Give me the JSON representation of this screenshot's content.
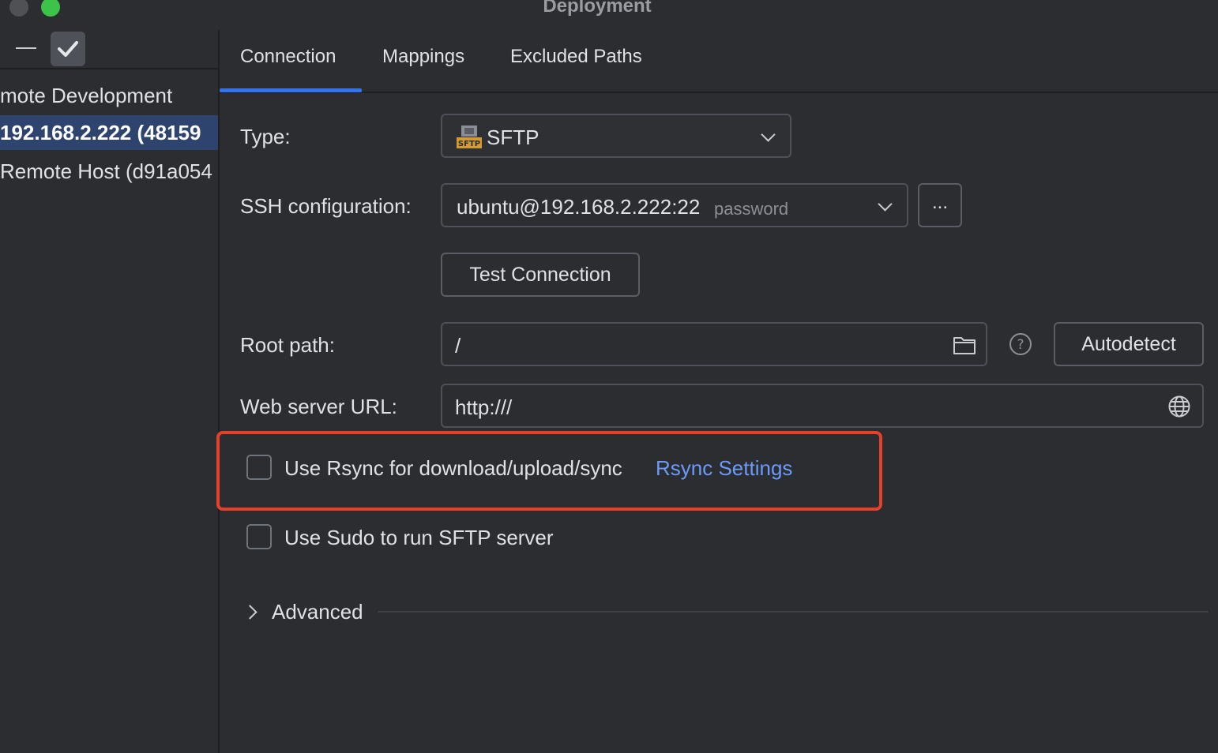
{
  "window": {
    "title": "Deployment"
  },
  "colors": {
    "accent": "#3574f0",
    "link": "#6b9bfa",
    "highlight": "#e5402a",
    "close": "#4f5155",
    "maximize": "#3dc24a"
  },
  "toolbar": {
    "remove_icon": "minus-icon",
    "apply_icon": "check-icon"
  },
  "sidebar": {
    "items": [
      {
        "label": "mote Development",
        "selected": false
      },
      {
        "label": "192.168.2.222 (48159",
        "selected": true
      },
      {
        "label": "Remote Host (d91a054",
        "selected": false
      }
    ]
  },
  "tabs": [
    {
      "label": "Connection",
      "active": true
    },
    {
      "label": "Mappings",
      "active": false
    },
    {
      "label": "Excluded Paths",
      "active": false
    }
  ],
  "form": {
    "type": {
      "label": "Type:",
      "value": "SFTP",
      "icon_text": "SFTP"
    },
    "ssh": {
      "label": "SSH configuration:",
      "value": "ubuntu@192.168.2.222:22",
      "auth": "password",
      "more_label": "..."
    },
    "test_button": "Test Connection",
    "root_path": {
      "label": "Root path:",
      "value": "/",
      "help_icon": "?",
      "autodetect_label": "Autodetect"
    },
    "web_url": {
      "label": "Web server URL:",
      "value": "http:///"
    },
    "rsync": {
      "label": "Use Rsync for download/upload/sync",
      "checked": false,
      "settings_link": "Rsync Settings"
    },
    "sudo": {
      "label": "Use Sudo to run SFTP server",
      "checked": false
    },
    "advanced": {
      "label": "Advanced"
    }
  }
}
